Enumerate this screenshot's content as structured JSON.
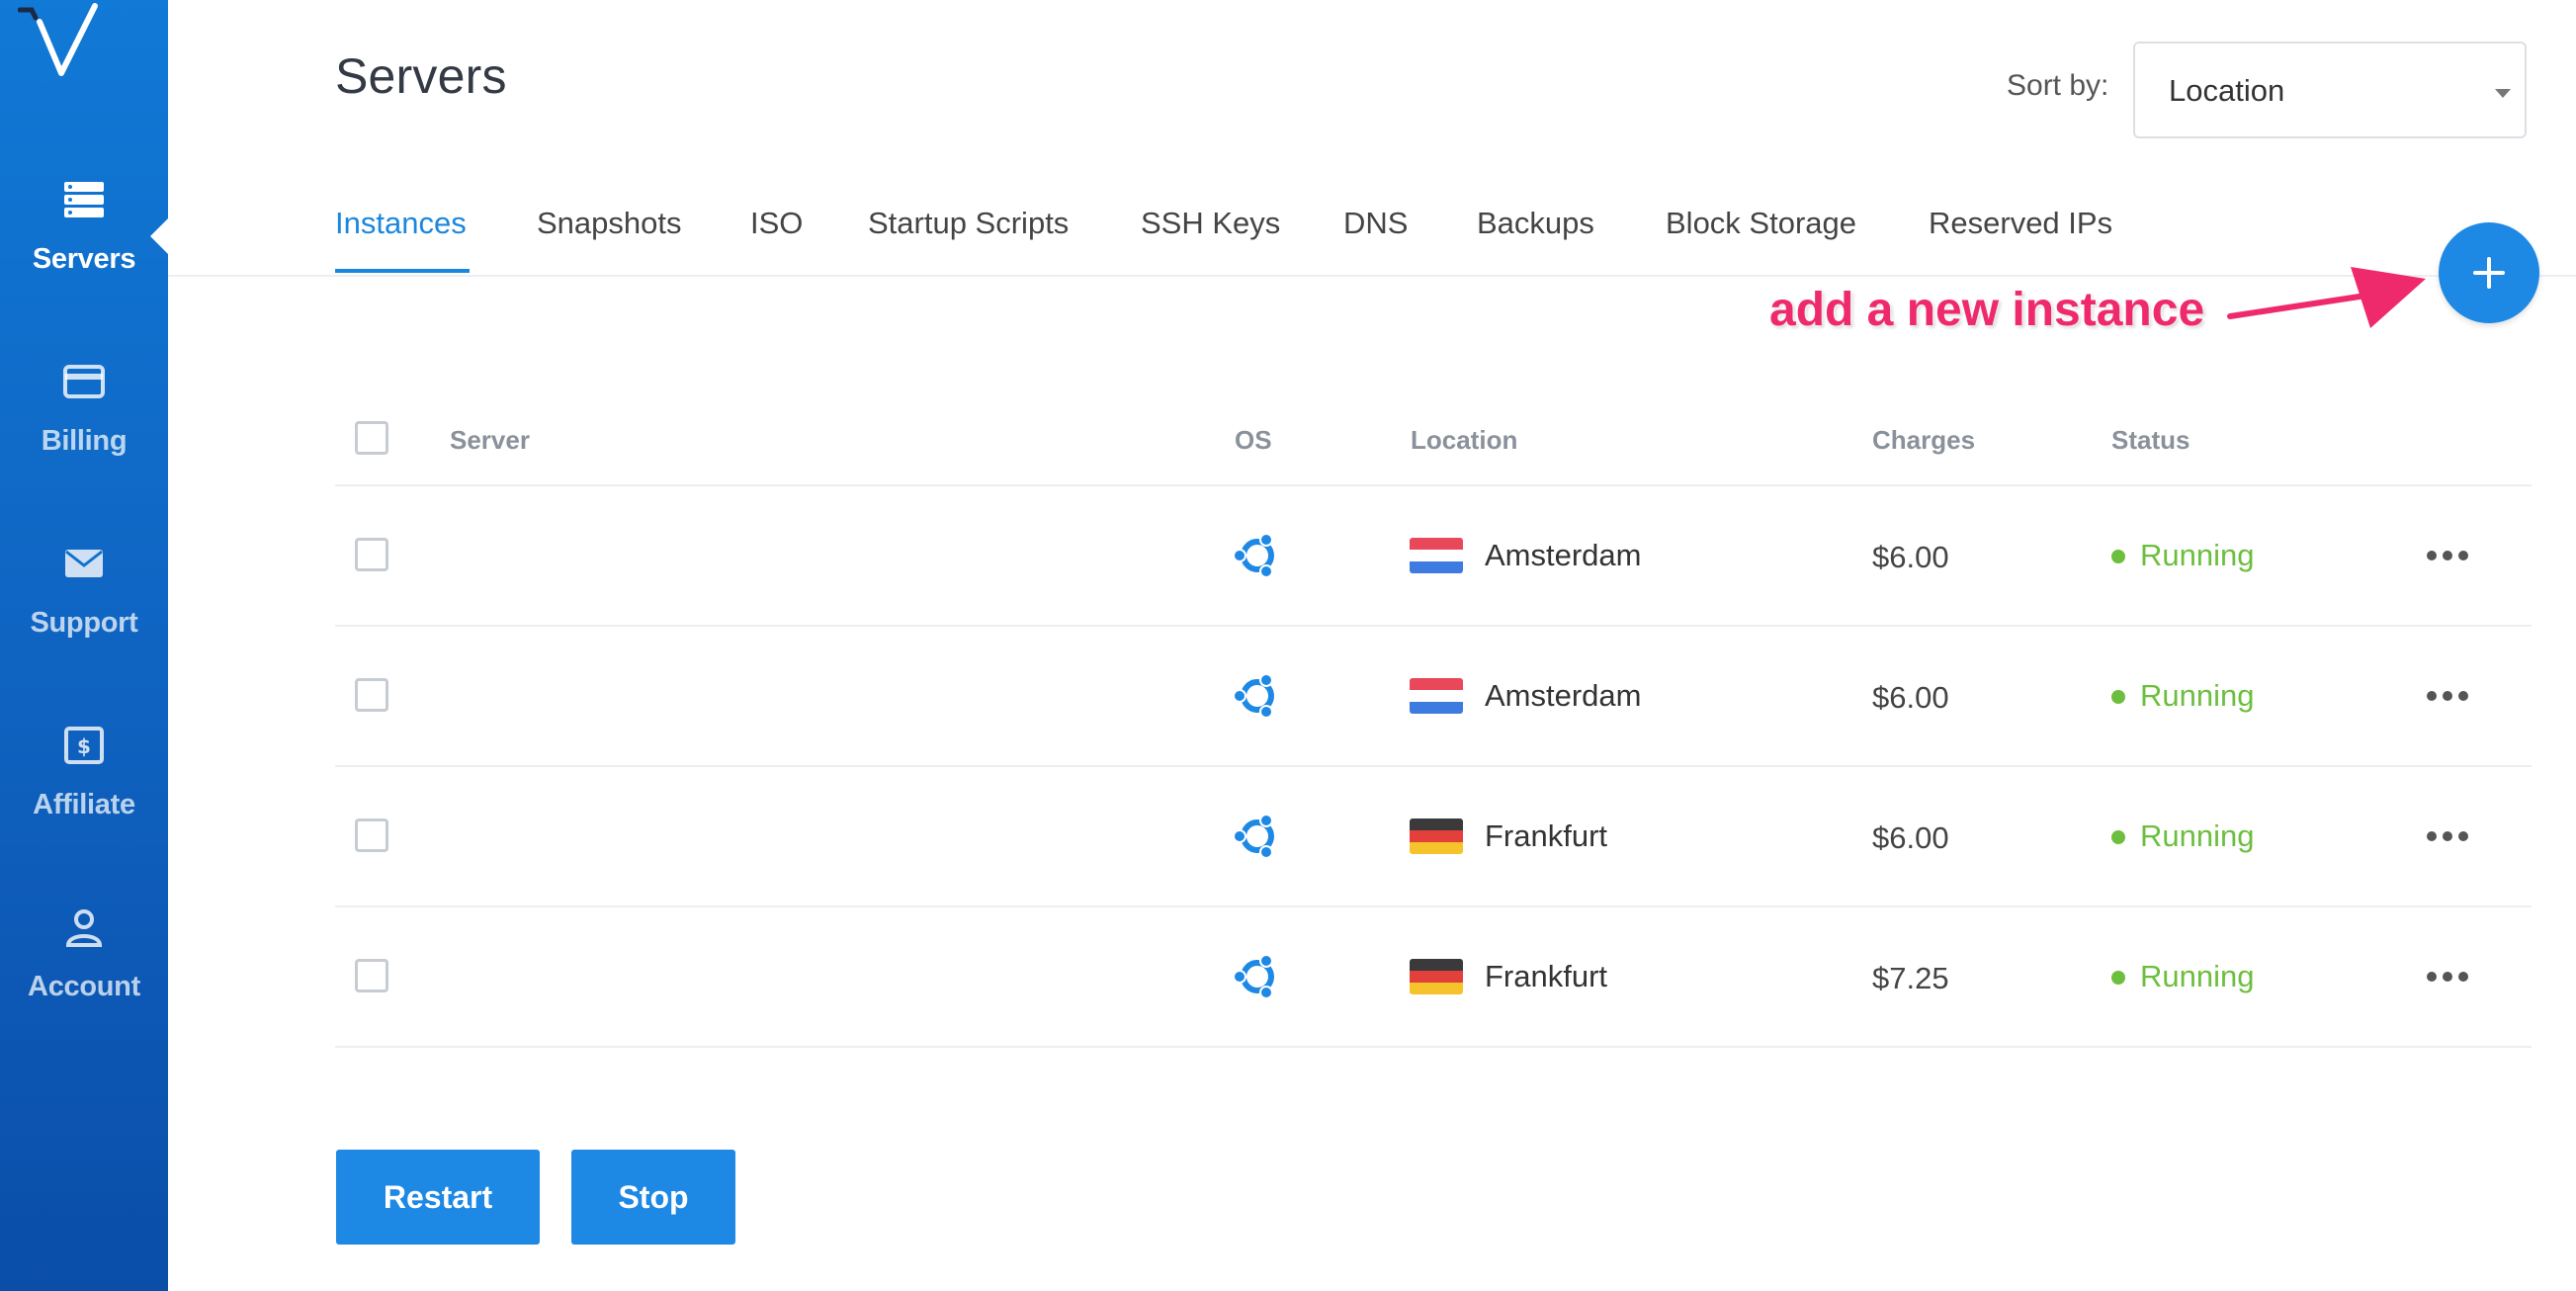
{
  "sidebar": {
    "logo": "vultr-v-logo",
    "items": [
      {
        "label": "Servers",
        "icon": "server-stack-icon",
        "active": true
      },
      {
        "label": "Billing",
        "icon": "credit-card-icon",
        "active": false
      },
      {
        "label": "Support",
        "icon": "envelope-icon",
        "active": false
      },
      {
        "label": "Affiliate",
        "icon": "dollar-bill-icon",
        "active": false
      },
      {
        "label": "Account",
        "icon": "user-icon",
        "active": false
      }
    ],
    "bg_color": "#1179d6"
  },
  "header": {
    "title": "Servers",
    "sort_label": "Sort by:",
    "sort_value": "Location"
  },
  "tabs": [
    {
      "label": "Instances",
      "active": true
    },
    {
      "label": "Snapshots"
    },
    {
      "label": "ISO"
    },
    {
      "label": "Startup Scripts"
    },
    {
      "label": "SSH Keys"
    },
    {
      "label": "DNS"
    },
    {
      "label": "Backups"
    },
    {
      "label": "Block Storage"
    },
    {
      "label": "Reserved IPs"
    }
  ],
  "annotation": {
    "text": "add a new instance",
    "color": "#ee2a6c"
  },
  "add_button": {
    "icon": "plus-icon",
    "color": "#1e88e5"
  },
  "table": {
    "columns": {
      "server": "Server",
      "os": "OS",
      "location": "Location",
      "charges": "Charges",
      "status": "Status"
    },
    "rows": [
      {
        "server": "",
        "os_icon": "ubuntu-icon",
        "flag": "netherlands-flag",
        "location": "Amsterdam",
        "charges": "$6.00",
        "status": "Running"
      },
      {
        "server": "",
        "os_icon": "ubuntu-icon",
        "flag": "netherlands-flag",
        "location": "Amsterdam",
        "charges": "$6.00",
        "status": "Running"
      },
      {
        "server": "",
        "os_icon": "ubuntu-icon",
        "flag": "germany-flag",
        "location": "Frankfurt",
        "charges": "$6.00",
        "status": "Running"
      },
      {
        "server": "",
        "os_icon": "ubuntu-icon",
        "flag": "germany-flag",
        "location": "Frankfurt",
        "charges": "$7.25",
        "status": "Running"
      }
    ],
    "status_color": "#6cbf3e"
  },
  "actions": {
    "restart_label": "Restart",
    "stop_label": "Stop"
  },
  "colors": {
    "accent": "#1e88e5",
    "tab_active": "#1a87df"
  }
}
